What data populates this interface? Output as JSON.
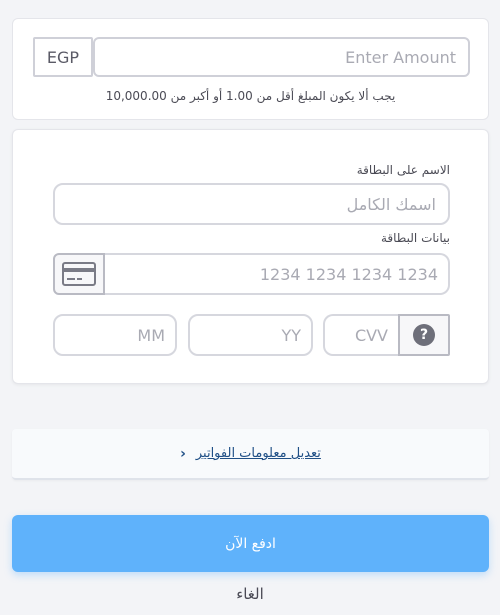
{
  "amount": {
    "currency": "EGP",
    "placeholder": "Enter Amount",
    "value": "",
    "hint": "يجب ألا يكون المبلغ أقل من 1.00 أو أكبر من 10,000.00"
  },
  "card_form": {
    "name_label": "الاسم على البطاقة",
    "name_placeholder": "اسمك الكامل",
    "card_label": "بيانات البطاقة",
    "card_icon": "credit-card-icon",
    "card_number_placeholder": "1234 1234 1234 1234",
    "month_placeholder": "MM",
    "year_placeholder": "YY",
    "cvv_placeholder": "CVV",
    "help_icon": "question-icon",
    "help_glyph": "?"
  },
  "billing": {
    "label": "تعديل معلومات الفواتير",
    "chevron": "‹",
    "chevron_icon": "chevron-left-icon"
  },
  "actions": {
    "pay_label": "ادفع الآن",
    "cancel_label": "الغاء"
  },
  "colors": {
    "primary_button": "#5fb2fb",
    "link": "#1f4f86",
    "background": "#f3f4f7"
  }
}
